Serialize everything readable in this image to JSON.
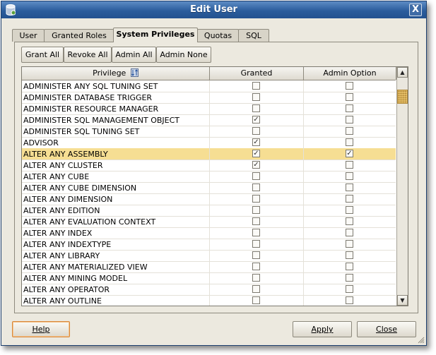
{
  "window": {
    "title": "Edit User",
    "close_label": "X"
  },
  "tabs": [
    {
      "label": "User",
      "active": false
    },
    {
      "label": "Granted Roles",
      "active": false
    },
    {
      "label": "System Privileges",
      "active": true
    },
    {
      "label": "Quotas",
      "active": false
    },
    {
      "label": "SQL",
      "active": false
    }
  ],
  "toolbar": {
    "grant_all": "Grant All",
    "revoke_all": "Revoke All",
    "admin_all": "Admin All",
    "admin_none": "Admin None"
  },
  "table": {
    "columns": {
      "privilege": "Privilege",
      "granted": "Granted",
      "admin_option": "Admin Option"
    },
    "rows": [
      {
        "privilege": "ADMINISTER ANY SQL TUNING SET",
        "granted": false,
        "admin": false,
        "selected": false
      },
      {
        "privilege": "ADMINISTER DATABASE TRIGGER",
        "granted": false,
        "admin": false,
        "selected": false
      },
      {
        "privilege": "ADMINISTER RESOURCE MANAGER",
        "granted": false,
        "admin": false,
        "selected": false
      },
      {
        "privilege": "ADMINISTER SQL MANAGEMENT OBJECT",
        "granted": true,
        "admin": false,
        "selected": false
      },
      {
        "privilege": "ADMINISTER SQL TUNING SET",
        "granted": false,
        "admin": false,
        "selected": false
      },
      {
        "privilege": "ADVISOR",
        "granted": true,
        "admin": false,
        "selected": false
      },
      {
        "privilege": "ALTER ANY ASSEMBLY",
        "granted": true,
        "admin": true,
        "selected": true
      },
      {
        "privilege": "ALTER ANY CLUSTER",
        "granted": true,
        "admin": false,
        "selected": false
      },
      {
        "privilege": "ALTER ANY CUBE",
        "granted": false,
        "admin": false,
        "selected": false
      },
      {
        "privilege": "ALTER ANY CUBE DIMENSION",
        "granted": false,
        "admin": false,
        "selected": false
      },
      {
        "privilege": "ALTER ANY DIMENSION",
        "granted": false,
        "admin": false,
        "selected": false
      },
      {
        "privilege": "ALTER ANY EDITION",
        "granted": false,
        "admin": false,
        "selected": false
      },
      {
        "privilege": "ALTER ANY EVALUATION CONTEXT",
        "granted": false,
        "admin": false,
        "selected": false
      },
      {
        "privilege": "ALTER ANY INDEX",
        "granted": false,
        "admin": false,
        "selected": false
      },
      {
        "privilege": "ALTER ANY INDEXTYPE",
        "granted": false,
        "admin": false,
        "selected": false
      },
      {
        "privilege": "ALTER ANY LIBRARY",
        "granted": false,
        "admin": false,
        "selected": false
      },
      {
        "privilege": "ALTER ANY MATERIALIZED VIEW",
        "granted": false,
        "admin": false,
        "selected": false
      },
      {
        "privilege": "ALTER ANY MINING MODEL",
        "granted": false,
        "admin": false,
        "selected": false
      },
      {
        "privilege": "ALTER ANY OPERATOR",
        "granted": false,
        "admin": false,
        "selected": false
      },
      {
        "privilege": "ALTER ANY OUTLINE",
        "granted": false,
        "admin": false,
        "selected": false
      }
    ]
  },
  "footer": {
    "help": "Help",
    "apply": "Apply",
    "close": "Close"
  },
  "colors": {
    "title_bar": "#2b5d9d",
    "selected_row": "#f6de93",
    "dialog_bg": "#ece9df",
    "scroll_thumb": "#f2cd74"
  }
}
